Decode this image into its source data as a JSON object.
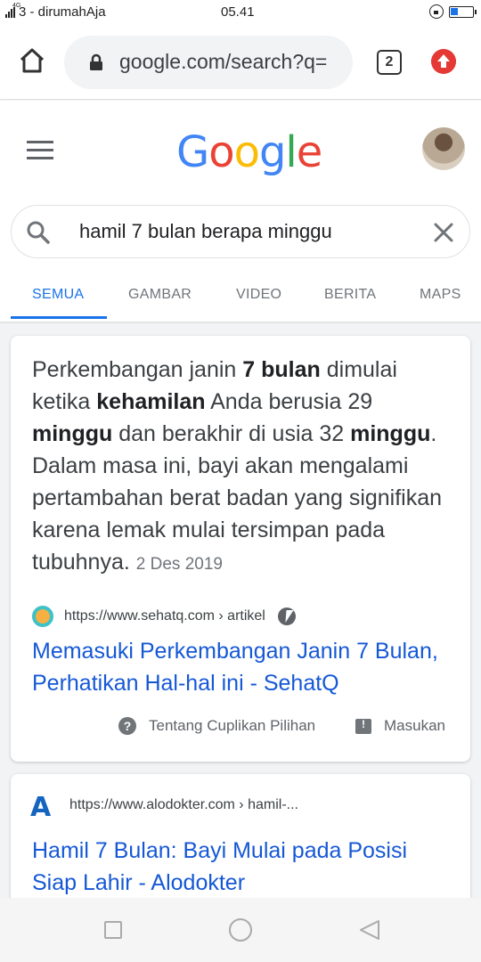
{
  "status_bar": {
    "network": "4G",
    "carrier": "3 - dirumahAja",
    "time": "05.41"
  },
  "browser": {
    "url": "google.com/search?q=",
    "tab_count": "2"
  },
  "google": {
    "logo_letters": [
      {
        "ch": "G",
        "color": "#4285F4"
      },
      {
        "ch": "o",
        "color": "#EA4335"
      },
      {
        "ch": "o",
        "color": "#FBBC05"
      },
      {
        "ch": "g",
        "color": "#4285F4"
      },
      {
        "ch": "l",
        "color": "#34A853"
      },
      {
        "ch": "e",
        "color": "#EA4335"
      }
    ],
    "query": "hamil 7 bulan berapa minggu",
    "tabs": [
      "SEMUA",
      "GAMBAR",
      "VIDEO",
      "BERITA",
      "MAPS"
    ],
    "active_tab": "SEMUA"
  },
  "featured_snippet": {
    "parts": [
      {
        "text": "Perkembangan janin ",
        "bold": false
      },
      {
        "text": "7 bulan",
        "bold": true
      },
      {
        "text": " dimulai ketika ",
        "bold": false
      },
      {
        "text": "kehamilan",
        "bold": true
      },
      {
        "text": " Anda berusia 29 ",
        "bold": false
      },
      {
        "text": "minggu",
        "bold": true
      },
      {
        "text": " dan berakhir di usia 32 ",
        "bold": false
      },
      {
        "text": "minggu",
        "bold": true
      },
      {
        "text": ". Dalam masa ini, bayi akan mengalami pertambahan berat badan yang signifikan karena lemak mulai tersimpan pada tubuhnya.",
        "bold": false
      }
    ],
    "date": "2 Des 2019",
    "source_url": "https://www.sehatq.com › artikel",
    "title": "Memasuki Perkembangan Janin 7 Bulan, Perhatikan Hal-hal ini - SehatQ",
    "about_label": "Tentang Cuplikan Pilihan",
    "feedback_label": "Masukan"
  },
  "result2": {
    "favicon_letter": "A",
    "source_url": "https://www.alodokter.com › hamil-...",
    "title": "Hamil 7 Bulan: Bayi Mulai pada Posisi Siap Lahir - Alodokter"
  }
}
